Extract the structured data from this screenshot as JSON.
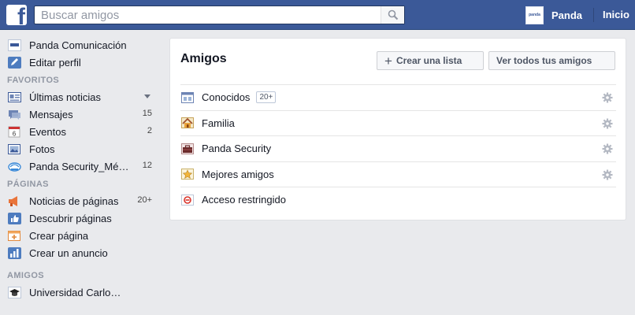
{
  "header": {
    "logo": "f",
    "search_placeholder": "Buscar amigos",
    "profile_name": "Panda",
    "profile_pic_text": "panda",
    "home_label": "Inicio",
    "colors": {
      "bar": "#3b5998"
    }
  },
  "sidebar": {
    "profile": [
      {
        "label": "Panda Comunicación",
        "icon": "panda-avatar-icon"
      },
      {
        "label": "Editar perfil",
        "icon": "pencil-icon"
      }
    ],
    "favorites_heading": "FAVORITOS",
    "favorites": [
      {
        "label": "Últimas noticias",
        "icon": "news-feed-icon",
        "count": ""
      },
      {
        "label": "Mensajes",
        "icon": "messages-icon",
        "count": "15"
      },
      {
        "label": "Eventos",
        "icon": "calendar-icon",
        "count": "2"
      },
      {
        "label": "Fotos",
        "icon": "photos-icon",
        "count": ""
      },
      {
        "label": "Panda Security_Mé…",
        "icon": "group-icon",
        "count": "12"
      }
    ],
    "pages_heading": "PÁGINAS",
    "pages": [
      {
        "label": "Noticias de páginas",
        "icon": "megaphone-icon",
        "count": "20+"
      },
      {
        "label": "Descubrir páginas",
        "icon": "thumbs-up-icon",
        "count": ""
      },
      {
        "label": "Crear página",
        "icon": "create-page-icon",
        "count": ""
      },
      {
        "label": "Crear un anuncio",
        "icon": "chart-icon",
        "count": ""
      }
    ],
    "friends_heading": "AMIGOS",
    "friends": [
      {
        "label": "Universidad Carlo…",
        "icon": "graduation-cap-icon"
      }
    ]
  },
  "main": {
    "title": "Amigos",
    "create_list_label": "Crear una lista",
    "see_all_label": "Ver todos tus amigos",
    "lists": [
      {
        "label": "Conocidos",
        "badge": "20+",
        "icon": "acquaintances-icon",
        "settings": true
      },
      {
        "label": "Familia",
        "badge": "",
        "icon": "house-icon",
        "settings": true
      },
      {
        "label": "Panda Security",
        "badge": "",
        "icon": "briefcase-icon",
        "settings": true
      },
      {
        "label": "Mejores amigos",
        "badge": "",
        "icon": "star-icon",
        "settings": true
      },
      {
        "label": "Acceso restringido",
        "badge": "",
        "icon": "restricted-icon",
        "settings": false
      }
    ]
  }
}
